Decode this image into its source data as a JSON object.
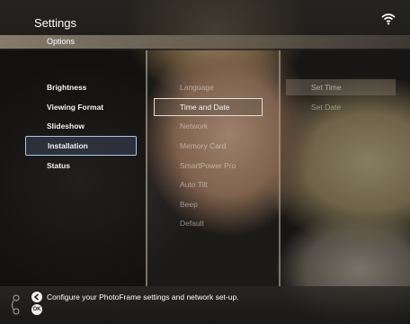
{
  "header": {
    "title": "Settings",
    "subtitle": "Options",
    "wifi_icon": "wifi-icon"
  },
  "menu_level1": [
    {
      "label": "Brightness"
    },
    {
      "label": "Viewing Format"
    },
    {
      "label": "Slideshow"
    },
    {
      "label": "Installation",
      "selected": true
    },
    {
      "label": "Status"
    }
  ],
  "menu_level2": [
    {
      "label": "Language"
    },
    {
      "label": "Time and Date",
      "selected": true
    },
    {
      "label": "Network"
    },
    {
      "label": "Memory Card"
    },
    {
      "label": "SmartPower Pro"
    },
    {
      "label": "Auto Tilt"
    },
    {
      "label": "Beep"
    },
    {
      "label": "Default"
    }
  ],
  "menu_level3": [
    {
      "label": "Set Time",
      "selected": true
    },
    {
      "label": "Set Date"
    }
  ],
  "footer": {
    "hint": "Configure your PhotoFrame settings and network set-up.",
    "ok_label": "OK",
    "icons": [
      "nav-ring-icon",
      "back-button-icon",
      "ok-button-icon"
    ]
  },
  "colors": {
    "selected_border_l1": "#a7c7e8",
    "selected_border_l2": "#e0ddd6",
    "text": "#f2f2f2"
  }
}
